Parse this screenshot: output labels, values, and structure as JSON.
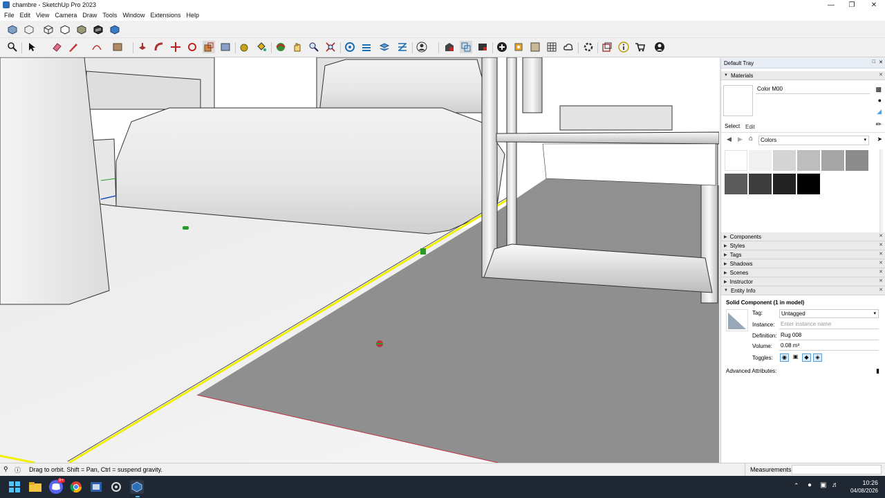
{
  "window": {
    "title": "chambre - SketchUp Pro 2023"
  },
  "menu": [
    "File",
    "Edit",
    "View",
    "Camera",
    "Draw",
    "Tools",
    "Window",
    "Extensions",
    "Help"
  ],
  "tray": {
    "title": "Default Tray",
    "materials": {
      "header": "Materials",
      "current_name": "Color M00",
      "tab_select": "Select",
      "tab_edit": "Edit",
      "library": "Colors",
      "swatches": [
        "#ffffff",
        "#f0f0f0",
        "#d4d4d4",
        "#bdbdbd",
        "#a6a6a6",
        "#8c8c8c",
        "#5a5a5a",
        "#3d3d3d",
        "#222222",
        "#000000"
      ]
    },
    "panels": [
      "Components",
      "Styles",
      "Tags",
      "Shadows",
      "Scenes",
      "Instructor"
    ],
    "entity_info": {
      "header": "Entity Info",
      "type": "Solid Component (1 in model)",
      "tag_label": "Tag:",
      "tag_value": "Untagged",
      "instance_label": "Instance:",
      "instance_placeholder": "Enter instance name",
      "definition_label": "Definition:",
      "definition_value": "Rug 008",
      "volume_label": "Volume:",
      "volume_value": "0.08 m³",
      "toggles_label": "Toggles:",
      "advanced_label": "Advanced Attributes:"
    }
  },
  "status": {
    "hint": "Drag to orbit. Shift = Pan, Ctrl = suspend gravity.",
    "measurements_label": "Measurements"
  },
  "taskbar": {
    "time": "10:26",
    "date": "04/08/2026",
    "discord_badge": "9+"
  },
  "colors": {
    "selection": "#f0f000",
    "accent": "#2c6fb5",
    "taskbar": "#1f2733"
  }
}
